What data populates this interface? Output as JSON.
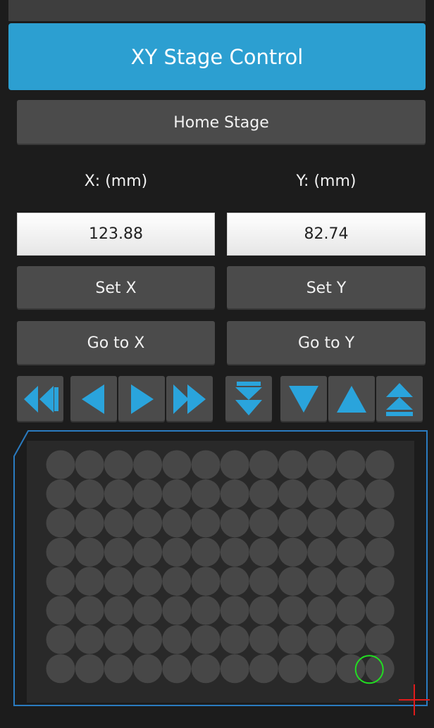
{
  "panel": {
    "title": "XY Stage Control",
    "home_label": "Home Stage",
    "x": {
      "label": "X: (mm)",
      "value": "123.88",
      "set_label": "Set X",
      "goto_label": "Go to X"
    },
    "y": {
      "label": "Y: (mm)",
      "value": "82.74",
      "set_label": "Set Y",
      "goto_label": "Go to Y"
    }
  },
  "jog_buttons": [
    {
      "name": "jog-x-fast-left-button",
      "icon": "double-left-arrow-icon"
    },
    {
      "name": "jog-x-left-button",
      "icon": "left-arrow-icon"
    },
    {
      "name": "jog-x-right-button",
      "icon": "right-arrow-icon"
    },
    {
      "name": "jog-x-fast-right-button",
      "icon": "double-right-arrow-icon"
    },
    {
      "name": "jog-y-fast-down-button",
      "icon": "double-down-arrow-icon"
    },
    {
      "name": "jog-y-down-button",
      "icon": "down-arrow-icon"
    },
    {
      "name": "jog-y-up-button",
      "icon": "up-arrow-icon"
    },
    {
      "name": "jog-y-fast-up-button",
      "icon": "double-up-arrow-icon"
    }
  ],
  "well_plate": {
    "rows": 8,
    "columns": 12,
    "selected_well": {
      "row": 8,
      "column": 12
    }
  },
  "colors": {
    "accent": "#2c9fd1",
    "button": "#4b4b4b",
    "background": "#1c1c1c",
    "well": "#474747",
    "plate_outline": "#2a7bc0",
    "selected_well": "#22dd22",
    "crosshair": "#e01b1b"
  }
}
